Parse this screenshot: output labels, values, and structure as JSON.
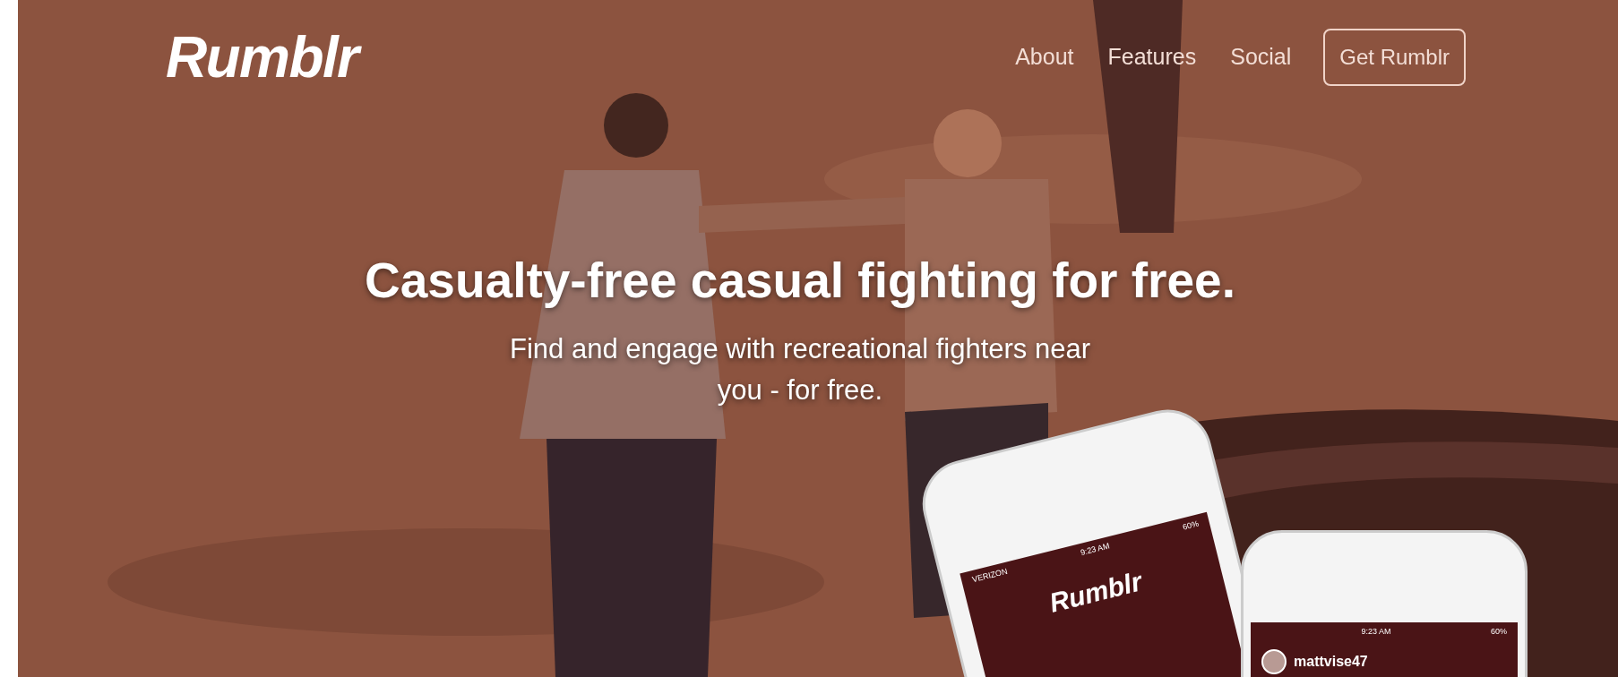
{
  "nav": {
    "logo": "Rumblr",
    "links": [
      {
        "label": "About"
      },
      {
        "label": "Features"
      },
      {
        "label": "Social"
      }
    ],
    "cta": "Get Rumblr"
  },
  "hero": {
    "headline": "Casualty-free casual fighting for free.",
    "subhead": "Find and engage with recreational fighters near you - for free."
  },
  "phones": [
    {
      "kind": "tilted",
      "carrier": "VERIZON",
      "time": "9:23 AM",
      "battery": "60%",
      "app_logo": "Rumblr"
    },
    {
      "kind": "upright",
      "time": "9:23 AM",
      "battery": "60%",
      "username": "mattvise47"
    }
  ]
}
